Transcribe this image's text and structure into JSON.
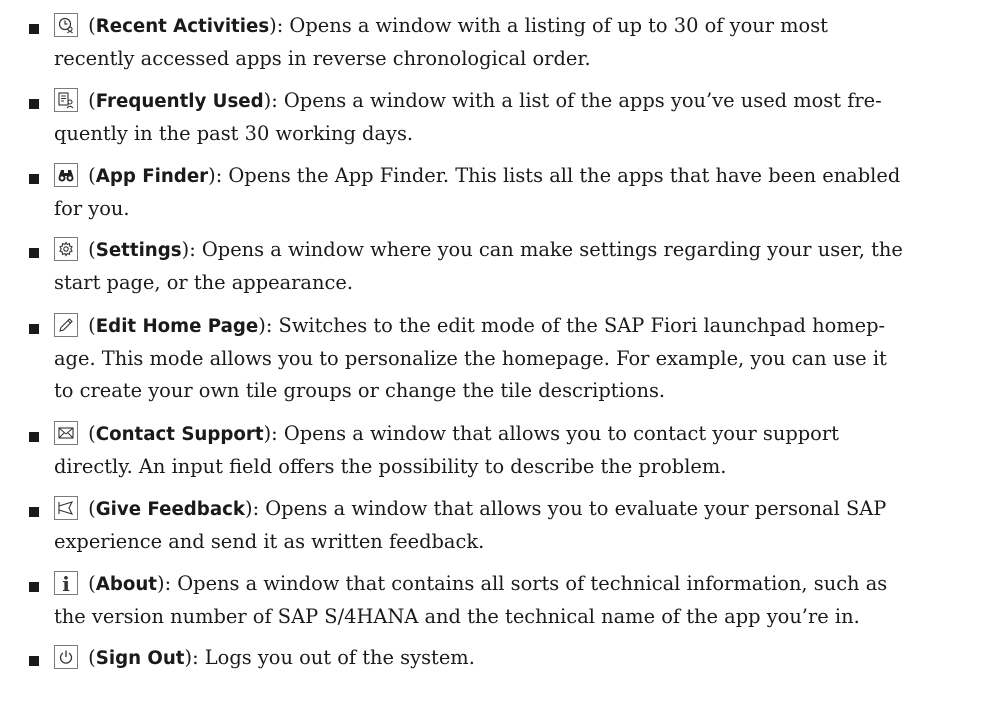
{
  "items": [
    {
      "icon": "recent-activities-icon",
      "term": "Recent Activities",
      "desc_line1": ": Opens a window with a listing of up to 30 of your most",
      "desc_line2": "recently accessed apps in reverse chronological order."
    },
    {
      "icon": "frequently-used-icon",
      "term": "Frequently Used",
      "desc_line1": ": Opens a window with a list of the apps you’ve used most fre-",
      "desc_line2": "quently in the past 30 working days."
    },
    {
      "icon": "binoculars-icon",
      "term": "App Finder",
      "desc_line1": ": Opens the App Finder. This lists all the apps that have been enabled",
      "desc_line2": "for you."
    },
    {
      "icon": "gear-icon",
      "term": "Settings",
      "desc_line1": ": Opens a window where you can make settings regarding your user, the",
      "desc_line2": "start page, or the appearance."
    },
    {
      "icon": "pencil-icon",
      "term": "Edit Home Page",
      "desc_line1": ": Switches to the edit mode of the SAP Fiori launchpad homep-",
      "desc_line2": "age. This mode allows you to personalize the homepage. For example, you can use it",
      "desc_line3": "to create your own tile groups or change the tile descriptions."
    },
    {
      "icon": "envelope-icon",
      "term": "Contact Support",
      "desc_line1": ": Opens a window that allows you to contact your support",
      "desc_line2": "directly. An input field offers the possibility to describe the problem."
    },
    {
      "icon": "feedback-icon",
      "term": "Give Feedback",
      "desc_line1": ": Opens a window that allows you to evaluate your personal SAP",
      "desc_line2": "experience and send it as written feedback."
    },
    {
      "icon": "info-icon",
      "info_glyph": "i",
      "term": "About",
      "desc_line1": ": Opens a window that contains all sorts of technical information, such as",
      "desc_line2": "the version number of SAP S/4HANA and the technical name of the app you’re in."
    },
    {
      "icon": "power-icon",
      "term": "Sign Out",
      "desc_line1": ": Logs you out of the system."
    }
  ],
  "paren_open": "(",
  "paren_close": ")"
}
